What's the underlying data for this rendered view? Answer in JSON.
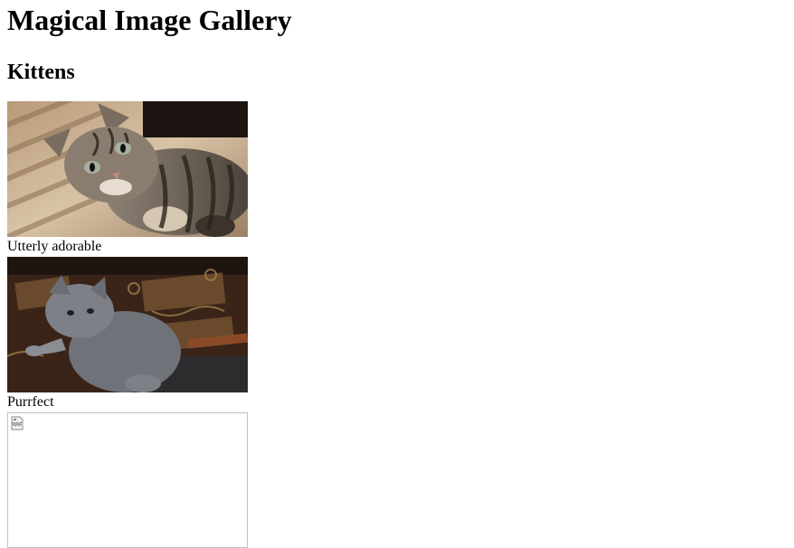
{
  "page": {
    "title": "Magical Image Gallery",
    "section_heading": "Kittens"
  },
  "gallery": {
    "items": [
      {
        "caption": "Utterly adorable",
        "image": "tabby-kitten-photo"
      },
      {
        "caption": "Purrfect",
        "image": "grey-kitten-photo"
      },
      {
        "caption": "",
        "image": "broken-image"
      }
    ]
  }
}
